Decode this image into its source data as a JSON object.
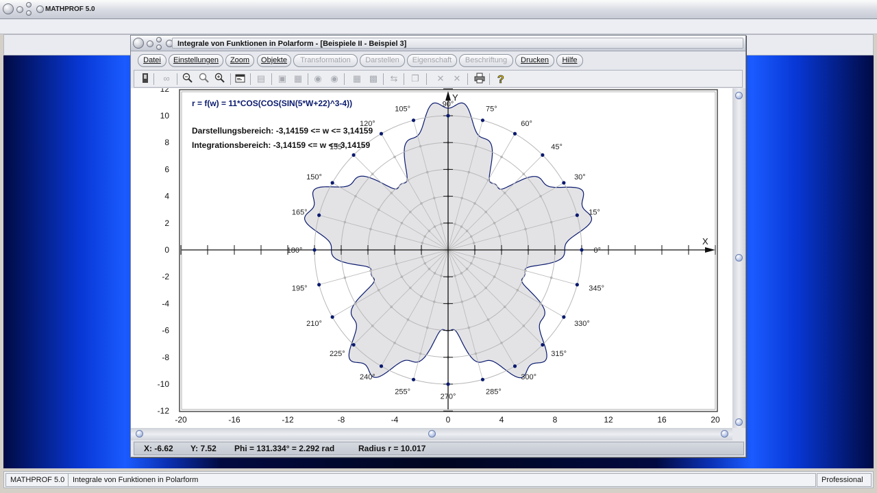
{
  "app": {
    "title": "MATHPROF 5.0"
  },
  "window": {
    "title": "Integrale von Funktionen in Polarform - [Beispiele II - Beispiel 3]"
  },
  "menu": [
    {
      "label": "Datei",
      "enabled": true
    },
    {
      "label": "Einstellungen",
      "enabled": true
    },
    {
      "label": "Zoom",
      "enabled": true
    },
    {
      "label": "Objekte",
      "enabled": true
    },
    {
      "label": "Transformation",
      "enabled": false
    },
    {
      "label": "Darstellen",
      "enabled": false
    },
    {
      "label": "Eigenschaft",
      "enabled": false
    },
    {
      "label": "Beschriftung",
      "enabled": false
    },
    {
      "label": "Drucken",
      "enabled": true
    },
    {
      "label": "Hilfe",
      "enabled": true
    }
  ],
  "toolbar_icons": [
    "stop-icon",
    "glasses-icon",
    "zoom-out-icon",
    "zoom-reset-icon",
    "zoom-in-icon",
    "properties-icon",
    "window-icon",
    "frame-icon",
    "box-icon",
    "target-icon",
    "target2-icon",
    "table-icon",
    "calc-icon",
    "transfer-icon",
    "copy-icon",
    "cross-icon",
    "cross2-icon",
    "print-icon",
    "help-icon"
  ],
  "plot": {
    "formula": "r = f(w) = 11*COS(COS(SIN(5*W+22)^3-4))",
    "range_label": "Darstellungsbereich:  -3,14159 <= w <= 3,14159",
    "integration_label": "Integrationsbereich:  -3,14159 <= w <= 3,14159",
    "x_axis_letter": "X",
    "y_axis_letter": "Y",
    "angle_labels": [
      "0°",
      "15°",
      "30°",
      "45°",
      "60°",
      "75°",
      "90°",
      "105°",
      "120°",
      "135°",
      "150°",
      "165°",
      "180°",
      "195°",
      "210°",
      "225°",
      "240°",
      "255°",
      "270°",
      "285°",
      "300°",
      "315°",
      "330°",
      "345°"
    ],
    "x_tick_labels": [
      "-20",
      "-16",
      "-12",
      "-8",
      "-4",
      "0",
      "4",
      "8",
      "12",
      "16",
      "20"
    ],
    "y_tick_labels": [
      "12",
      "10",
      "8",
      "6",
      "4",
      "2",
      "0",
      "-2",
      "-4",
      "-6",
      "-8",
      "-10",
      "-12"
    ]
  },
  "chart_data": {
    "type": "line",
    "function": "r = f(w) = 11*COS(COS(SIN(5*W+22)^3-4))",
    "w_range": [
      -3.14159,
      3.14159
    ],
    "xlim": [
      -20,
      20
    ],
    "ylim": [
      -12,
      12
    ],
    "grid": true,
    "polar_grid_radii": [
      2,
      4,
      6,
      8,
      10
    ],
    "angle_step_deg": 15
  },
  "status": {
    "x": "X: -6.62",
    "y": "Y: 7.52",
    "phi": "Phi = 131.334° = 2.292 rad",
    "radius": "Radius r = 10.017"
  },
  "bottom": {
    "app": "MATHPROF 5.0",
    "module": "Integrale von Funktionen in Polarform",
    "edition": "Professional"
  },
  "colors": {
    "curve": "#0a1a6e",
    "fill": "#e3e3e6",
    "grid": "#b8b8b8",
    "desktop_blue": "#1a5bff"
  }
}
